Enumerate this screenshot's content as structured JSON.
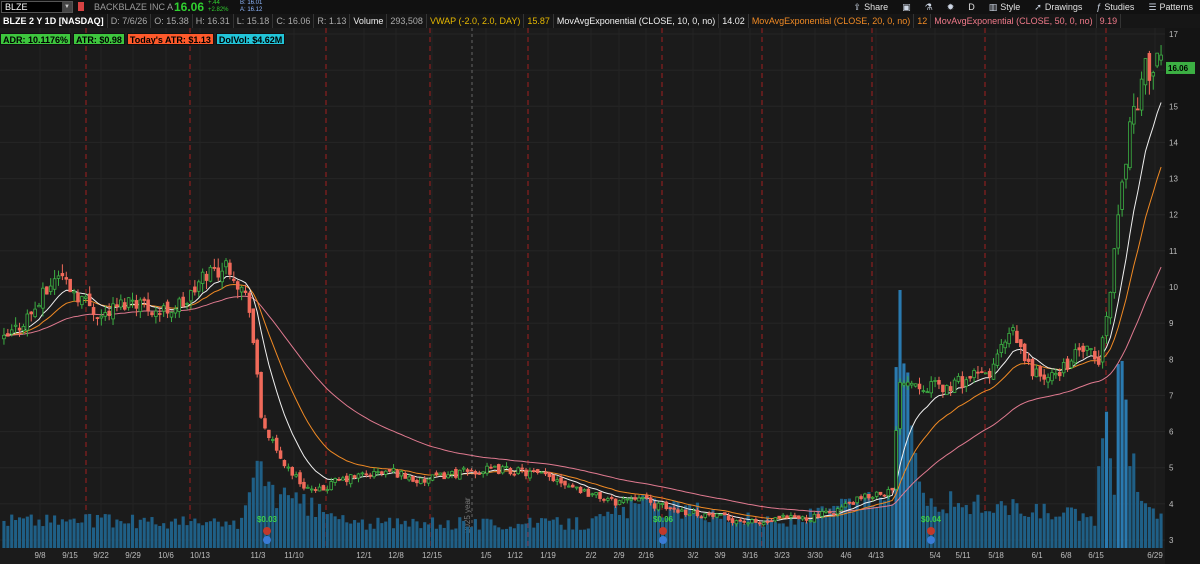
{
  "topbar": {
    "symbol": "BLZE",
    "company": "BACKBLAZE INC A",
    "last": "16.06",
    "change_abs": "+.44",
    "change_pct": "+2.82%",
    "bid": "B: 16.01",
    "ask": "A: 16.12",
    "tools": [
      {
        "icon": "share-icon",
        "glyph": "⇪",
        "label": "Share"
      },
      {
        "icon": "save-icon",
        "glyph": "▣",
        "label": ""
      },
      {
        "icon": "flask-icon",
        "glyph": "⚗",
        "label": ""
      },
      {
        "icon": "gear-icon",
        "glyph": "✹",
        "label": ""
      },
      {
        "icon": "",
        "glyph": "",
        "label": "D"
      },
      {
        "icon": "style-icon",
        "glyph": "▥",
        "label": "Style"
      },
      {
        "icon": "cursor-icon",
        "glyph": "➚",
        "label": "Drawings"
      },
      {
        "icon": "studies-icon",
        "glyph": "ƒ",
        "label": "Studies"
      },
      {
        "icon": "patterns-icon",
        "glyph": "☰",
        "label": "Patterns"
      }
    ]
  },
  "studybar": {
    "title": "BLZE 2 Y 1D [NASDAQ]",
    "date": "D: 7/6/26",
    "open": "O: 15.38",
    "high": "H: 16.31",
    "low": "L: 15.18",
    "close": "C: 16.06",
    "range": "R: 1.13",
    "volume_label": "Volume",
    "volume_value": "293,508",
    "vwap_label": "VWAP (-2.0, 2.0, DAY)",
    "vwap_value": "15.87",
    "ma10_label": "MovAvgExponential (CLOSE, 10, 0, no)",
    "ma10_value": "14.02",
    "ma20_label": "MovAvgExponential (CLOSE, 20, 0, no)",
    "ma20_value": "12",
    "ma50_label": "MovAvgExponential (CLOSE, 50, 0, no)",
    "ma50_value": "9.19"
  },
  "labels": [
    {
      "text": "ADR: 10.1176%",
      "bg": "#3ec63e",
      "fg": "#000000"
    },
    {
      "text": "ATR: $0.98",
      "bg": "#3ec63e",
      "fg": "#000000"
    },
    {
      "text": "Today's ATR: $1.13",
      "bg": "#ff5a2b",
      "fg": "#000000"
    },
    {
      "text": "DolVol: $4.62M",
      "bg": "#22c4d8",
      "fg": "#000000"
    }
  ],
  "colors": {
    "up": "#3cb043",
    "down": "#f06a5a",
    "ema10": "#f0f0f0",
    "ema20": "#f08a24",
    "ema50": "#e07a90",
    "volume": "#1f5f86",
    "volume_spike": "#2a7ab0",
    "event_line": "#b02020",
    "price_tag": "#3cb043"
  },
  "chart_data": {
    "type": "candlestick",
    "price_axis": {
      "min": 3,
      "max": 17,
      "ticks": [
        "17",
        "16",
        "15",
        "14",
        "13",
        "12",
        "11",
        "10",
        "9",
        "8",
        "7",
        "6",
        "5",
        "4",
        "3"
      ]
    },
    "last_price": "16.06",
    "x_labels": [
      "9/8",
      "9/15",
      "9/22",
      "9/29",
      "10/6",
      "10/13",
      "11/3",
      "11/10",
      "12/1",
      "12/8",
      "12/15",
      "1/5",
      "1/12",
      "1/19",
      "2/2",
      "2/9",
      "2/16",
      "3/2",
      "3/9",
      "3/16",
      "3/23",
      "3/30",
      "4/6",
      "4/13",
      "5/4",
      "5/11",
      "5/18",
      "6/1",
      "6/8",
      "6/15",
      "6/29"
    ],
    "year_label": "2025 year",
    "dividends": [
      {
        "date": "11/3",
        "text": "$0.03"
      },
      {
        "date": "2/16",
        "text": "$0.06"
      },
      {
        "date": "5/4",
        "text": "$0.04"
      }
    ],
    "event_dates": [
      "9/22",
      "10/13",
      "11/10",
      "12/8",
      "1/19",
      "2/16",
      "3/9",
      "4/13",
      "5/18",
      "6/15"
    ],
    "close_anchors": [
      [
        0,
        8.5
      ],
      [
        8,
        9.4
      ],
      [
        14,
        10.4
      ],
      [
        18,
        9.9
      ],
      [
        25,
        9.2
      ],
      [
        33,
        9.7
      ],
      [
        40,
        9.3
      ],
      [
        47,
        9.6
      ],
      [
        52,
        10.4
      ],
      [
        58,
        10.6
      ],
      [
        63,
        9.5
      ],
      [
        66,
        6.4
      ],
      [
        70,
        5.4
      ],
      [
        76,
        4.6
      ],
      [
        80,
        4.3
      ],
      [
        85,
        4.6
      ],
      [
        92,
        4.8
      ],
      [
        100,
        4.9
      ],
      [
        107,
        4.6
      ],
      [
        113,
        4.8
      ],
      [
        120,
        4.9
      ],
      [
        128,
        4.95
      ],
      [
        135,
        4.85
      ],
      [
        142,
        4.7
      ],
      [
        150,
        4.3
      ],
      [
        157,
        4.05
      ],
      [
        163,
        4.25
      ],
      [
        166,
        4.0
      ],
      [
        172,
        3.85
      ],
      [
        180,
        3.7
      ],
      [
        188,
        3.55
      ],
      [
        194,
        3.45
      ],
      [
        200,
        3.6
      ],
      [
        206,
        3.6
      ],
      [
        212,
        3.75
      ],
      [
        218,
        4.05
      ],
      [
        224,
        4.3
      ],
      [
        228,
        4.35
      ],
      [
        230,
        7.5
      ],
      [
        236,
        7.3
      ],
      [
        242,
        7.2
      ],
      [
        248,
        7.5
      ],
      [
        253,
        7.6
      ],
      [
        256,
        8.3
      ],
      [
        259,
        8.7
      ],
      [
        263,
        7.8
      ],
      [
        268,
        7.4
      ],
      [
        273,
        7.9
      ],
      [
        277,
        8.3
      ],
      [
        281,
        7.9
      ],
      [
        283,
        9.1
      ],
      [
        286,
        12.0
      ],
      [
        289,
        14.5
      ],
      [
        293,
        16.0
      ],
      [
        297,
        16.1
      ]
    ],
    "volume_anchors": [
      [
        0,
        0.12
      ],
      [
        60,
        0.1
      ],
      [
        66,
        0.33
      ],
      [
        70,
        0.22
      ],
      [
        90,
        0.1
      ],
      [
        150,
        0.1
      ],
      [
        163,
        0.18
      ],
      [
        200,
        0.1
      ],
      [
        228,
        0.22
      ],
      [
        230,
        1.0
      ],
      [
        232,
        0.78
      ],
      [
        236,
        0.2
      ],
      [
        280,
        0.12
      ],
      [
        283,
        0.62
      ],
      [
        285,
        0.25
      ],
      [
        287,
        0.96
      ],
      [
        289,
        0.35
      ],
      [
        291,
        0.27
      ],
      [
        297,
        0.12
      ]
    ]
  }
}
